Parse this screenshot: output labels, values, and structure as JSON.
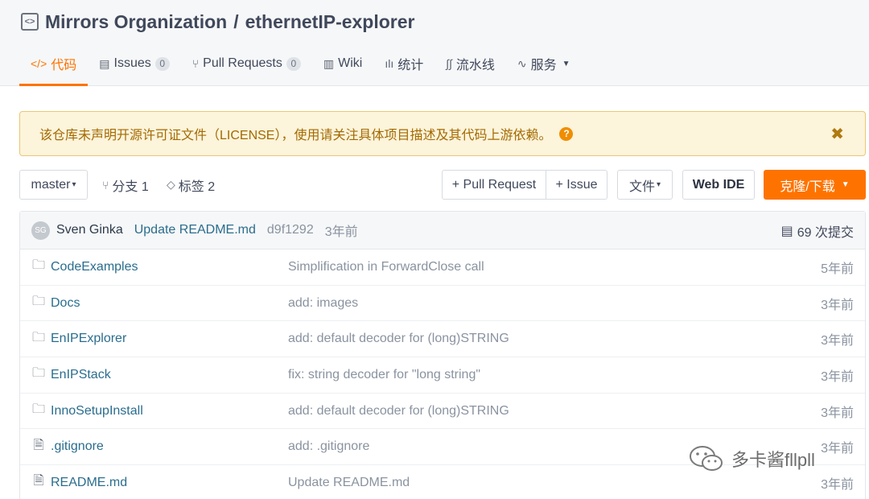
{
  "repo": {
    "org": "Mirrors Organization",
    "separator": "/",
    "name": "ethernetIP-explorer"
  },
  "tabs": [
    {
      "label": "代码",
      "icon": "</>",
      "active": true
    },
    {
      "label": "Issues",
      "icon": "▤",
      "count": "0"
    },
    {
      "label": "Pull Requests",
      "icon": "⑂",
      "count": "0"
    },
    {
      "label": "Wiki",
      "icon": "▥"
    },
    {
      "label": "统计",
      "icon": "ılı"
    },
    {
      "label": "流水线",
      "icon": "∫∫"
    },
    {
      "label": "服务",
      "icon": "∿",
      "caret": "▼"
    }
  ],
  "alert": {
    "text": "该仓库未声明开源许可证文件（LICENSE），使用请关注具体项目描述及其代码上游依赖。",
    "help": "?",
    "close": "✖"
  },
  "toolbar": {
    "branch": "master",
    "branch_caret": "▾",
    "branches": "分支 1",
    "tags": "标签 2",
    "pull_request": "+ Pull Request",
    "issue": "+ Issue",
    "files": "文件",
    "web_ide": "Web IDE",
    "clone": "克隆/下载"
  },
  "commit": {
    "avatar_initials": "SG",
    "author": "Sven Ginka",
    "message": "Update README.md",
    "sha": "d9f1292",
    "time": "3年前",
    "count": "69 次提交"
  },
  "files": [
    {
      "type": "folder",
      "name": "CodeExamples",
      "message": "Simplification in ForwardClose call",
      "age": "5年前"
    },
    {
      "type": "folder",
      "name": "Docs",
      "message": "add: images",
      "age": "3年前"
    },
    {
      "type": "folder",
      "name": "EnIPExplorer",
      "message": "add: default decoder for (long)STRING",
      "age": "3年前"
    },
    {
      "type": "folder",
      "name": "EnIPStack",
      "message": "fix: string decoder for \"long string\"",
      "age": "3年前"
    },
    {
      "type": "folder",
      "name": "InnoSetupInstall",
      "message": "add: default decoder for (long)STRING",
      "age": "3年前"
    },
    {
      "type": "file",
      "name": ".gitignore",
      "message": "add: .gitignore",
      "age": "3年前"
    },
    {
      "type": "file",
      "name": "README.md",
      "message": "Update README.md",
      "age": "3年前"
    }
  ],
  "icons": {
    "folder": "🗀",
    "file": "🗎"
  },
  "watermark": {
    "text": "多卡酱fllpll"
  },
  "colors": {
    "accent": "#fe7300",
    "link": "#2a6d8e",
    "alert_bg": "#fcf4db",
    "alert_text": "#a36a00"
  }
}
